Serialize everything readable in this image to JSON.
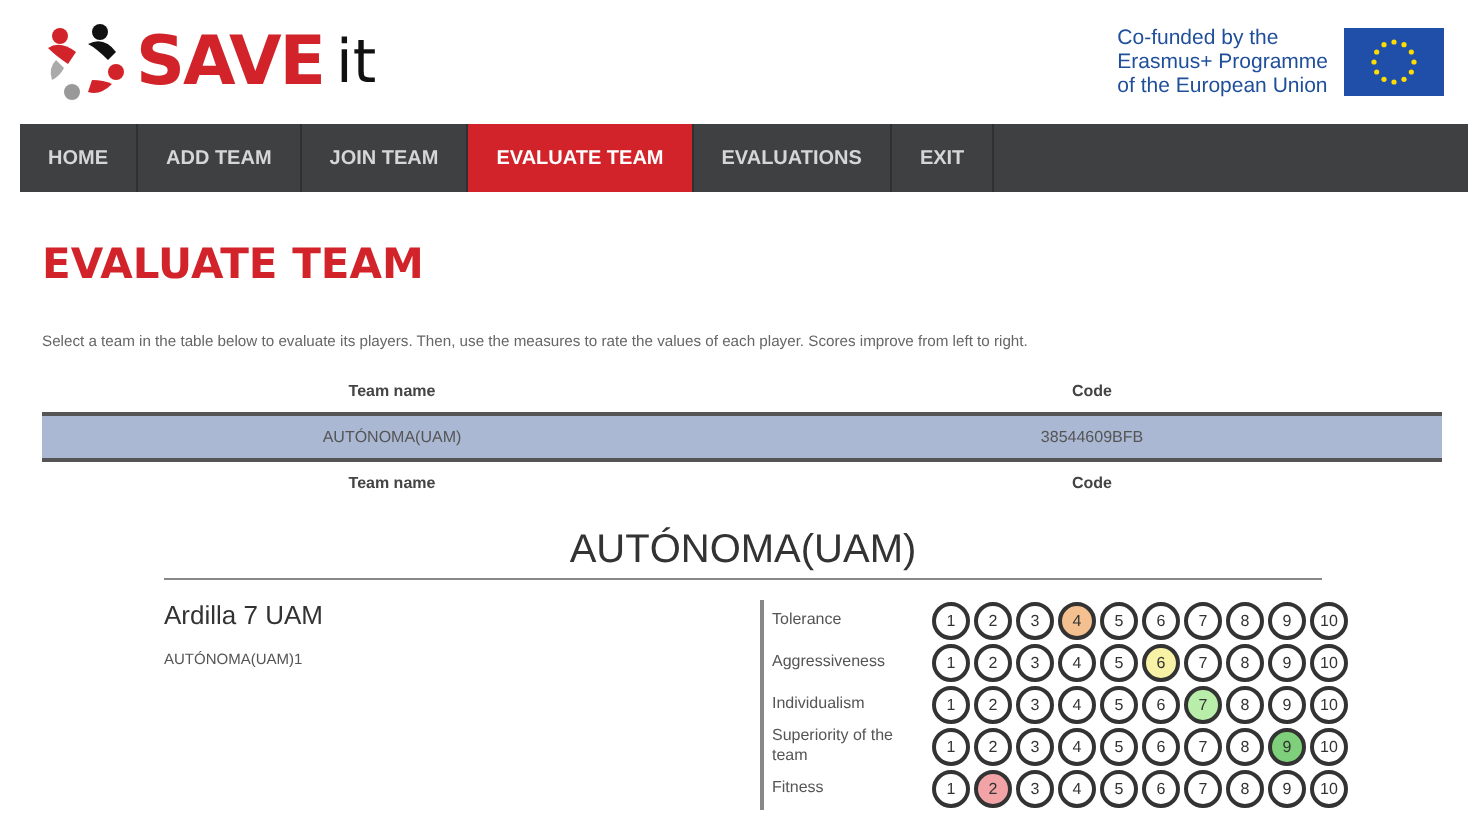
{
  "header": {
    "logo_text_bold": "SAVE",
    "logo_text_light": "it",
    "eu_text": [
      "Co-funded by the",
      "Erasmus+ Programme",
      "of the European Union"
    ]
  },
  "nav": [
    {
      "label": "HOME",
      "selected": false
    },
    {
      "label": "ADD TEAM",
      "selected": false
    },
    {
      "label": "JOIN TEAM",
      "selected": false
    },
    {
      "label": "EVALUATE TEAM",
      "selected": true
    },
    {
      "label": "EVALUATIONS",
      "selected": false
    },
    {
      "label": "EXIT",
      "selected": false
    }
  ],
  "page_title": "EVALUATE TEAM",
  "description": "Select a team in the table below to evaluate its players. Then, use the measures to rate the values of each player. Scores improve from left to right.",
  "table": {
    "columns": [
      "Team name",
      "Code"
    ],
    "rows": [
      {
        "cells": [
          "AUTÓNOMA(UAM)",
          "38544609BFB"
        ],
        "selected": true
      }
    ],
    "footer": [
      "Team name",
      "Code"
    ]
  },
  "team_heading": "AUTÓNOMA(UAM)",
  "player": {
    "name": "Ardilla 7 UAM",
    "team": "AUTÓNOMA(UAM)1"
  },
  "measures": [
    {
      "label": "Tolerance",
      "color": "#f5c08f",
      "scores": [
        {
          "label": "1",
          "selected": false
        },
        {
          "label": "2",
          "selected": false
        },
        {
          "label": "3",
          "selected": false
        },
        {
          "label": "4",
          "selected": true
        },
        {
          "label": "5",
          "selected": false
        },
        {
          "label": "6",
          "selected": false
        },
        {
          "label": "7",
          "selected": false
        },
        {
          "label": "8",
          "selected": false
        },
        {
          "label": "9",
          "selected": false
        },
        {
          "label": "10",
          "selected": false
        }
      ]
    },
    {
      "label": "Aggressiveness",
      "color": "#f7f2a6",
      "scores": [
        {
          "label": "1",
          "selected": false
        },
        {
          "label": "2",
          "selected": false
        },
        {
          "label": "3",
          "selected": false
        },
        {
          "label": "4",
          "selected": false
        },
        {
          "label": "5",
          "selected": false
        },
        {
          "label": "6",
          "selected": true
        },
        {
          "label": "7",
          "selected": false
        },
        {
          "label": "8",
          "selected": false
        },
        {
          "label": "9",
          "selected": false
        },
        {
          "label": "10",
          "selected": false
        }
      ]
    },
    {
      "label": "Individualism",
      "color": "#b9eeaa",
      "scores": [
        {
          "label": "1",
          "selected": false
        },
        {
          "label": "2",
          "selected": false
        },
        {
          "label": "3",
          "selected": false
        },
        {
          "label": "4",
          "selected": false
        },
        {
          "label": "5",
          "selected": false
        },
        {
          "label": "6",
          "selected": false
        },
        {
          "label": "7",
          "selected": true
        },
        {
          "label": "8",
          "selected": false
        },
        {
          "label": "9",
          "selected": false
        },
        {
          "label": "10",
          "selected": false
        }
      ]
    },
    {
      "label": "Superiority of the team",
      "color": "#7fd07a",
      "scores": [
        {
          "label": "1",
          "selected": false
        },
        {
          "label": "2",
          "selected": false
        },
        {
          "label": "3",
          "selected": false
        },
        {
          "label": "4",
          "selected": false
        },
        {
          "label": "5",
          "selected": false
        },
        {
          "label": "6",
          "selected": false
        },
        {
          "label": "7",
          "selected": false
        },
        {
          "label": "8",
          "selected": false
        },
        {
          "label": "9",
          "selected": true
        },
        {
          "label": "10",
          "selected": false
        }
      ]
    },
    {
      "label": "Fitness",
      "color": "#f2a3a6",
      "scores": [
        {
          "label": "1",
          "selected": false
        },
        {
          "label": "2",
          "selected": true
        },
        {
          "label": "3",
          "selected": false
        },
        {
          "label": "4",
          "selected": false
        },
        {
          "label": "5",
          "selected": false
        },
        {
          "label": "6",
          "selected": false
        },
        {
          "label": "7",
          "selected": false
        },
        {
          "label": "8",
          "selected": false
        },
        {
          "label": "9",
          "selected": false
        },
        {
          "label": "10",
          "selected": false
        }
      ]
    }
  ]
}
